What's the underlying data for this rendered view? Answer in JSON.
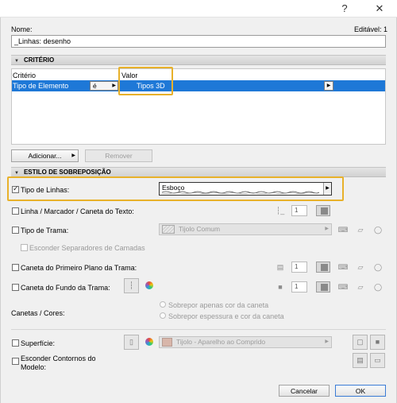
{
  "window": {
    "help_label": "?",
    "close_label": "✕"
  },
  "header": {
    "name_label": "Nome:",
    "editable_label": "Editável: 1",
    "name_value": "_Linhas: desenho"
  },
  "criteria": {
    "section_title": "CRITÉRIO",
    "col_criterion": "Critério",
    "col_value": "Valor",
    "row": {
      "criterion": "Tipo de Elemento",
      "operator": "é",
      "value": "Tipos 3D"
    },
    "add_button": "Adicionar...",
    "remove_button": "Remover"
  },
  "override": {
    "section_title": "ESTILO DE SOBREPOSIÇÃO",
    "line_type": {
      "label": "Tipo de Linhas:",
      "checked": true,
      "value": "Esboço"
    },
    "line_marker": {
      "label": "Linha / Marcador / Caneta do Texto:",
      "pen": "1"
    },
    "fill_type": {
      "label": "Tipo de Trama:",
      "value": "Tijolo Comum"
    },
    "hide_fill_sep": {
      "label": "Esconder Separadores de Camadas"
    },
    "fg_pen": {
      "label": "Caneta do Primeiro Plano da Trama:",
      "pen": "1"
    },
    "bg_pen": {
      "label": "Caneta do Fundo da Trama:",
      "pen": "1"
    },
    "pens_colors": {
      "label": "Canetas / Cores:",
      "option1": "Sobrepor apenas cor da caneta",
      "option2": "Sobrepor espessura e cor da caneta"
    },
    "surface": {
      "label": "Superfície:",
      "value": "Tijolo - Aparelho ao Comprido"
    },
    "hide_contours": {
      "label": "Esconder Contornos do Modelo:"
    }
  },
  "footer": {
    "cancel_button": "Cancelar",
    "ok_button": "OK"
  },
  "colors": {
    "selection_blue": "#1e78d7",
    "highlight_yellow": "#e8b12a"
  }
}
